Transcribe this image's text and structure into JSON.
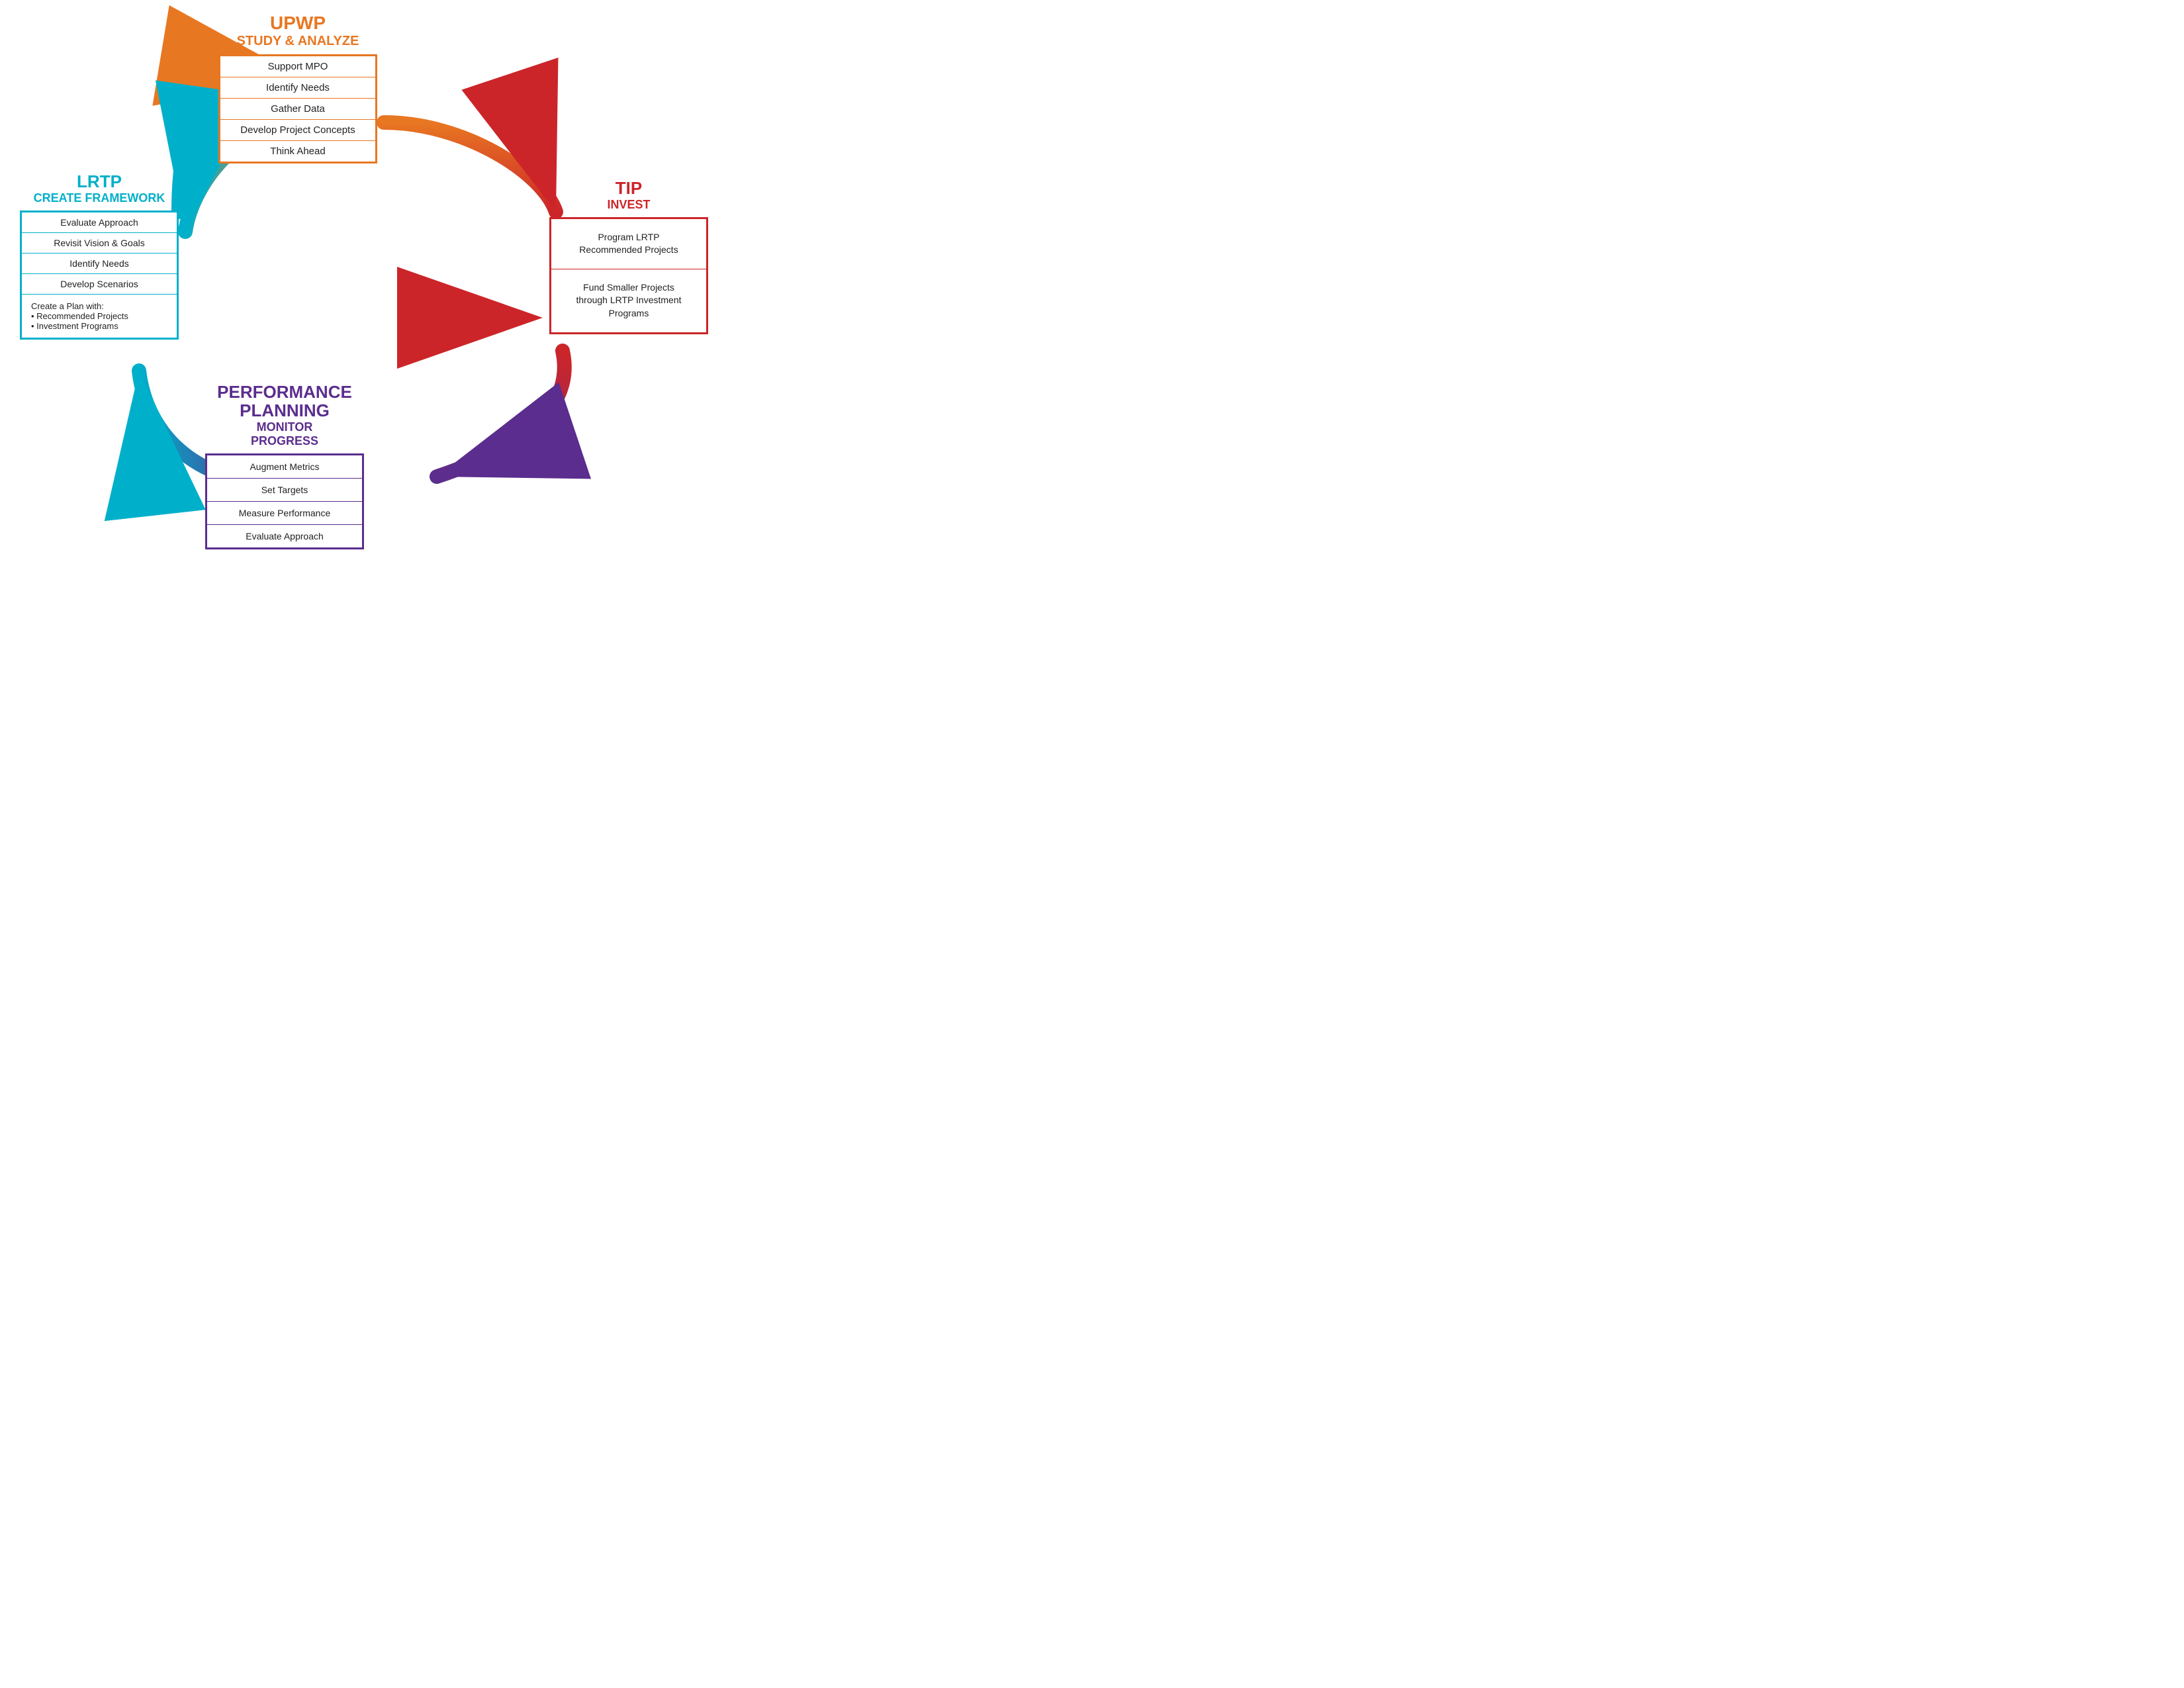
{
  "upwp": {
    "title": "UPWP",
    "subtitle": "STUDY & ANALYZE",
    "items": [
      "Support MPO",
      "Identify Needs",
      "Gather Data",
      "Develop Project Concepts",
      "Think Ahead"
    ]
  },
  "lrtp": {
    "title": "LRTP",
    "subtitle": "CREATE FRAMEWORK",
    "items": [
      "Evaluate Approach",
      "Revisit Vision & Goals",
      "Identify Needs",
      "Develop Scenarios"
    ],
    "extra": "Create a Plan with:\n• Recommended Projects\n• Investment Programs"
  },
  "tip": {
    "title": "TIP",
    "subtitle": "INVEST",
    "items": [
      "Program LRTP\nRecommended Projects",
      "Fund Smaller Projects\nthrough LRTP Investment\nPrograms"
    ]
  },
  "perf": {
    "title": "PERFORMANCE\nPLANNING",
    "subtitle": "MONITOR\nPROGRESS",
    "items": [
      "Augment Metrics",
      "Set Targets",
      "Measure Performance",
      "Evaluate Approach"
    ]
  }
}
